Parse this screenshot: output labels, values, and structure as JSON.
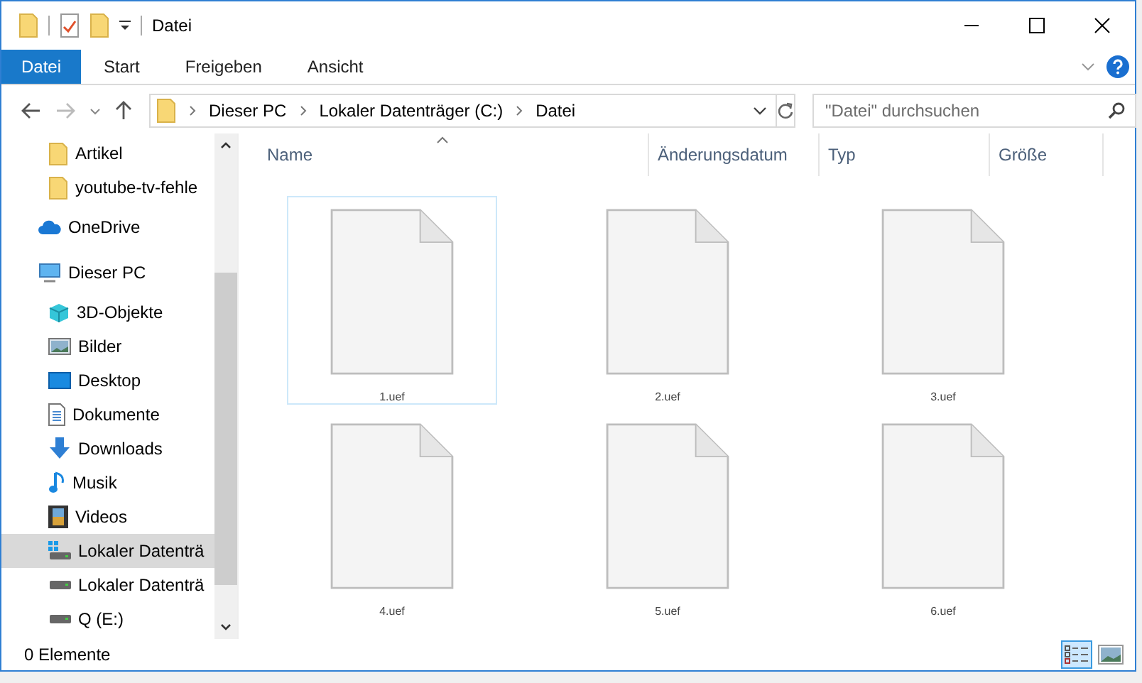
{
  "window": {
    "title": "Datei"
  },
  "ribbon": {
    "tabs": [
      {
        "label": "Datei",
        "selected": true
      },
      {
        "label": "Start",
        "selected": false
      },
      {
        "label": "Freigeben",
        "selected": false
      },
      {
        "label": "Ansicht",
        "selected": false
      }
    ]
  },
  "address_bar": {
    "path": [
      "Dieser PC",
      "Lokaler Datenträger (C:)",
      "Datei"
    ]
  },
  "search": {
    "placeholder": "\"Datei\" durchsuchen"
  },
  "sidebar": {
    "pinned_items": [
      {
        "label": "Artikel",
        "kind": "folder",
        "selected": false
      },
      {
        "label": "youtube-tv-fehle",
        "kind": "folder",
        "selected": false
      }
    ],
    "items": [
      {
        "label": "OneDrive",
        "kind": "cloud",
        "selected": false
      },
      {
        "label": "Dieser PC",
        "kind": "pc",
        "selected": false,
        "children": [
          {
            "label": "3D-Objekte",
            "kind": "cube",
            "selected": false
          },
          {
            "label": "Bilder",
            "kind": "pictures",
            "selected": false
          },
          {
            "label": "Desktop",
            "kind": "desktop",
            "selected": false
          },
          {
            "label": "Dokumente",
            "kind": "document",
            "selected": false
          },
          {
            "label": "Downloads",
            "kind": "download",
            "selected": false
          },
          {
            "label": "Musik",
            "kind": "music",
            "selected": false
          },
          {
            "label": "Videos",
            "kind": "video",
            "selected": false
          },
          {
            "label": "Lokaler Datenträ",
            "kind": "system-drive",
            "selected": true
          },
          {
            "label": "Lokaler Datenträ",
            "kind": "drive",
            "selected": false
          },
          {
            "label": "Q (E:)",
            "kind": "drive",
            "selected": false
          }
        ]
      }
    ]
  },
  "table": {
    "columns": [
      "Name",
      "Änderungsdatum",
      "Typ",
      "Größe"
    ]
  },
  "files": [
    {
      "name": "1.uef",
      "selected": true
    },
    {
      "name": "2.uef",
      "selected": false
    },
    {
      "name": "3.uef",
      "selected": false
    },
    {
      "name": "4.uef",
      "selected": false
    },
    {
      "name": "5.uef",
      "selected": false
    },
    {
      "name": "6.uef",
      "selected": false
    }
  ],
  "status_bar": {
    "text": "0 Elemente",
    "views": [
      {
        "kind": "details",
        "selected": true
      },
      {
        "kind": "large-icons",
        "selected": false
      }
    ]
  }
}
